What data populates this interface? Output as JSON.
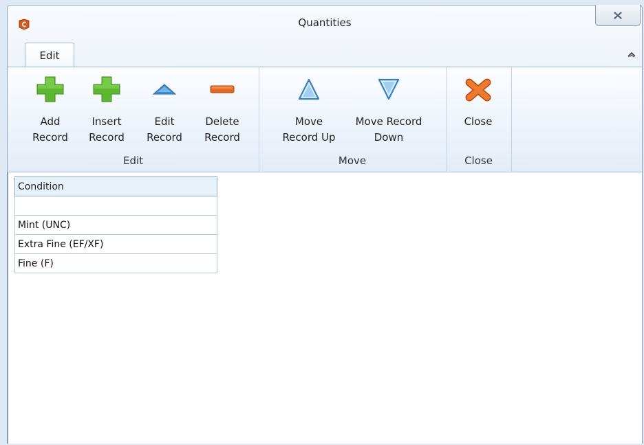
{
  "window": {
    "title": "Quantities"
  },
  "tabs": [
    {
      "label": "Edit",
      "active": true
    }
  ],
  "ribbon": {
    "groups": [
      {
        "label": "Edit",
        "buttons": [
          {
            "line1": "Add",
            "line2": "Record",
            "icon": "add-icon"
          },
          {
            "line1": "Insert",
            "line2": "Record",
            "icon": "insert-icon"
          },
          {
            "line1": "Edit",
            "line2": "Record",
            "icon": "edit-icon"
          },
          {
            "line1": "Delete",
            "line2": "Record",
            "icon": "delete-icon"
          }
        ]
      },
      {
        "label": "Move",
        "buttons": [
          {
            "line1": "Move",
            "line2": "Record Up",
            "icon": "arrow-up-icon"
          },
          {
            "line1": "Move Record",
            "line2": "Down",
            "icon": "arrow-down-icon"
          }
        ]
      },
      {
        "label": "Close",
        "buttons": [
          {
            "line1": "Close",
            "line2": "",
            "icon": "close-icon"
          }
        ]
      }
    ]
  },
  "grid": {
    "columns": [
      "Condition"
    ],
    "rows": [
      [
        ""
      ],
      [
        "Mint (UNC)"
      ],
      [
        "Extra Fine (EF/XF)"
      ],
      [
        "Fine (F)"
      ]
    ]
  },
  "colors": {
    "add_green": "#5cb82e",
    "delete_orange": "#e8671a",
    "arrow_blue": "#3f8fd9",
    "close_orange": "#ef7a2c"
  }
}
